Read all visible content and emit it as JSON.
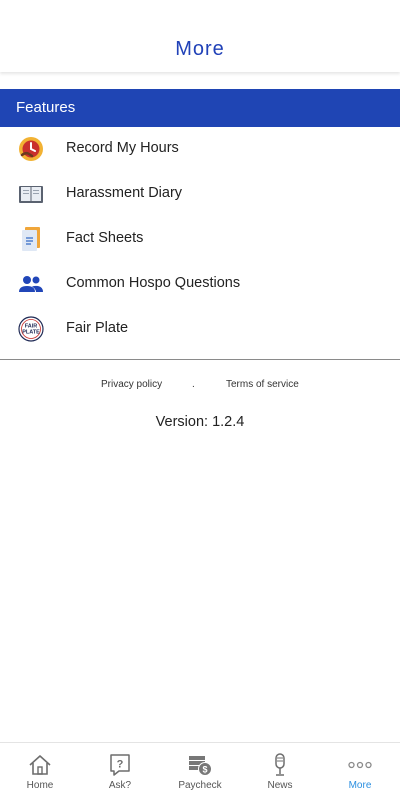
{
  "header": {
    "title": "More"
  },
  "features": {
    "heading": "Features",
    "items": [
      {
        "label": "Record My Hours",
        "icon": "clock-hand-icon"
      },
      {
        "label": "Harassment Diary",
        "icon": "open-book-icon"
      },
      {
        "label": "Fact Sheets",
        "icon": "document-icon"
      },
      {
        "label": "Common Hospo Questions",
        "icon": "people-icon"
      },
      {
        "label": "Fair Plate",
        "icon": "fair-plate-logo-icon"
      }
    ]
  },
  "footer_links": {
    "privacy": "Privacy policy",
    "separator": ".",
    "terms": "Terms of service"
  },
  "version": "Version: 1.2.4",
  "tabs": [
    {
      "label": "Home",
      "icon": "home-icon",
      "active": false
    },
    {
      "label": "Ask?",
      "icon": "question-icon",
      "active": false
    },
    {
      "label": "Paycheck",
      "icon": "paycheck-icon",
      "active": false
    },
    {
      "label": "News",
      "icon": "microphone-icon",
      "active": false
    },
    {
      "label": "More",
      "icon": "more-dots-icon",
      "active": true
    }
  ],
  "colors": {
    "primary": "#1f45b4",
    "title": "#2142b8",
    "active_tab": "#2b8fe0"
  }
}
